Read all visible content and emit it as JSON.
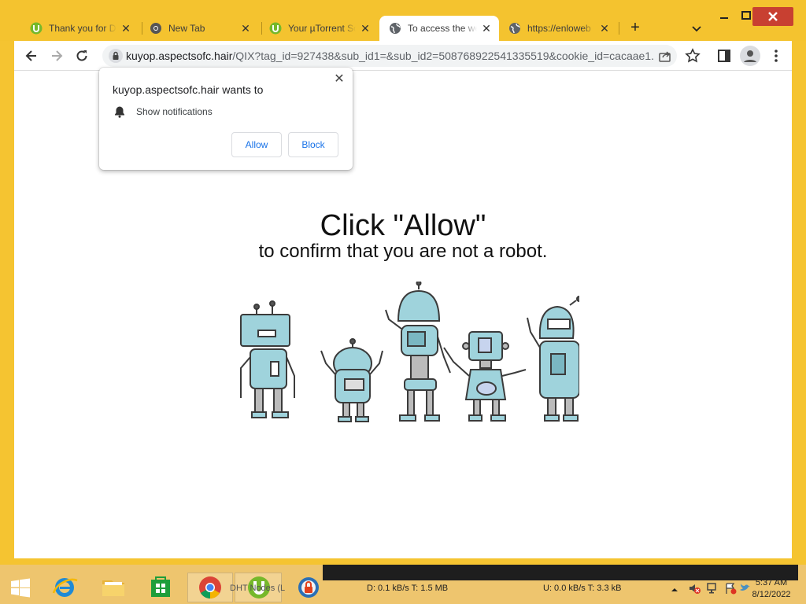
{
  "browser": {
    "tabs": [
      {
        "label": "Thank you for Do",
        "icon": "utorrent-icon",
        "active": false
      },
      {
        "label": "New Tab",
        "icon": "chrome-icon",
        "active": false
      },
      {
        "label": "Your µTorrent So",
        "icon": "utorrent-icon",
        "active": false
      },
      {
        "label": "To access the we",
        "icon": "globe-icon",
        "active": true
      },
      {
        "label": "https://enloweb",
        "icon": "globe-icon",
        "active": false
      }
    ],
    "new_tab_symbol": "+",
    "address": {
      "host": "kuyop.aspectsofc.hair",
      "path": "/QIX?tag_id=927438&sub_id1=&sub_id2=508768922541335519&cookie_id=cacaae1..."
    }
  },
  "popup": {
    "title": "kuyop.aspectsofc.hair wants to",
    "permission": "Show notifications",
    "allow_label": "Allow",
    "block_label": "Block",
    "close_symbol": "✕"
  },
  "page": {
    "headline": "Click \"Allow\"",
    "subline": "to confirm that you are not a robot."
  },
  "taskbar": {
    "app_label": "DHT Nodes (L",
    "download": "D: 0.1 kB/s T: 1.5 MB",
    "upload": "U: 0.0 kB/s T: 3.3 kB",
    "time": "5:37 AM",
    "date": "8/12/2022"
  },
  "colors": {
    "frame": "#f4c32f",
    "close_button": "#c84031",
    "link_blue": "#1a73e8",
    "robot_fill": "#9fd3dc"
  }
}
